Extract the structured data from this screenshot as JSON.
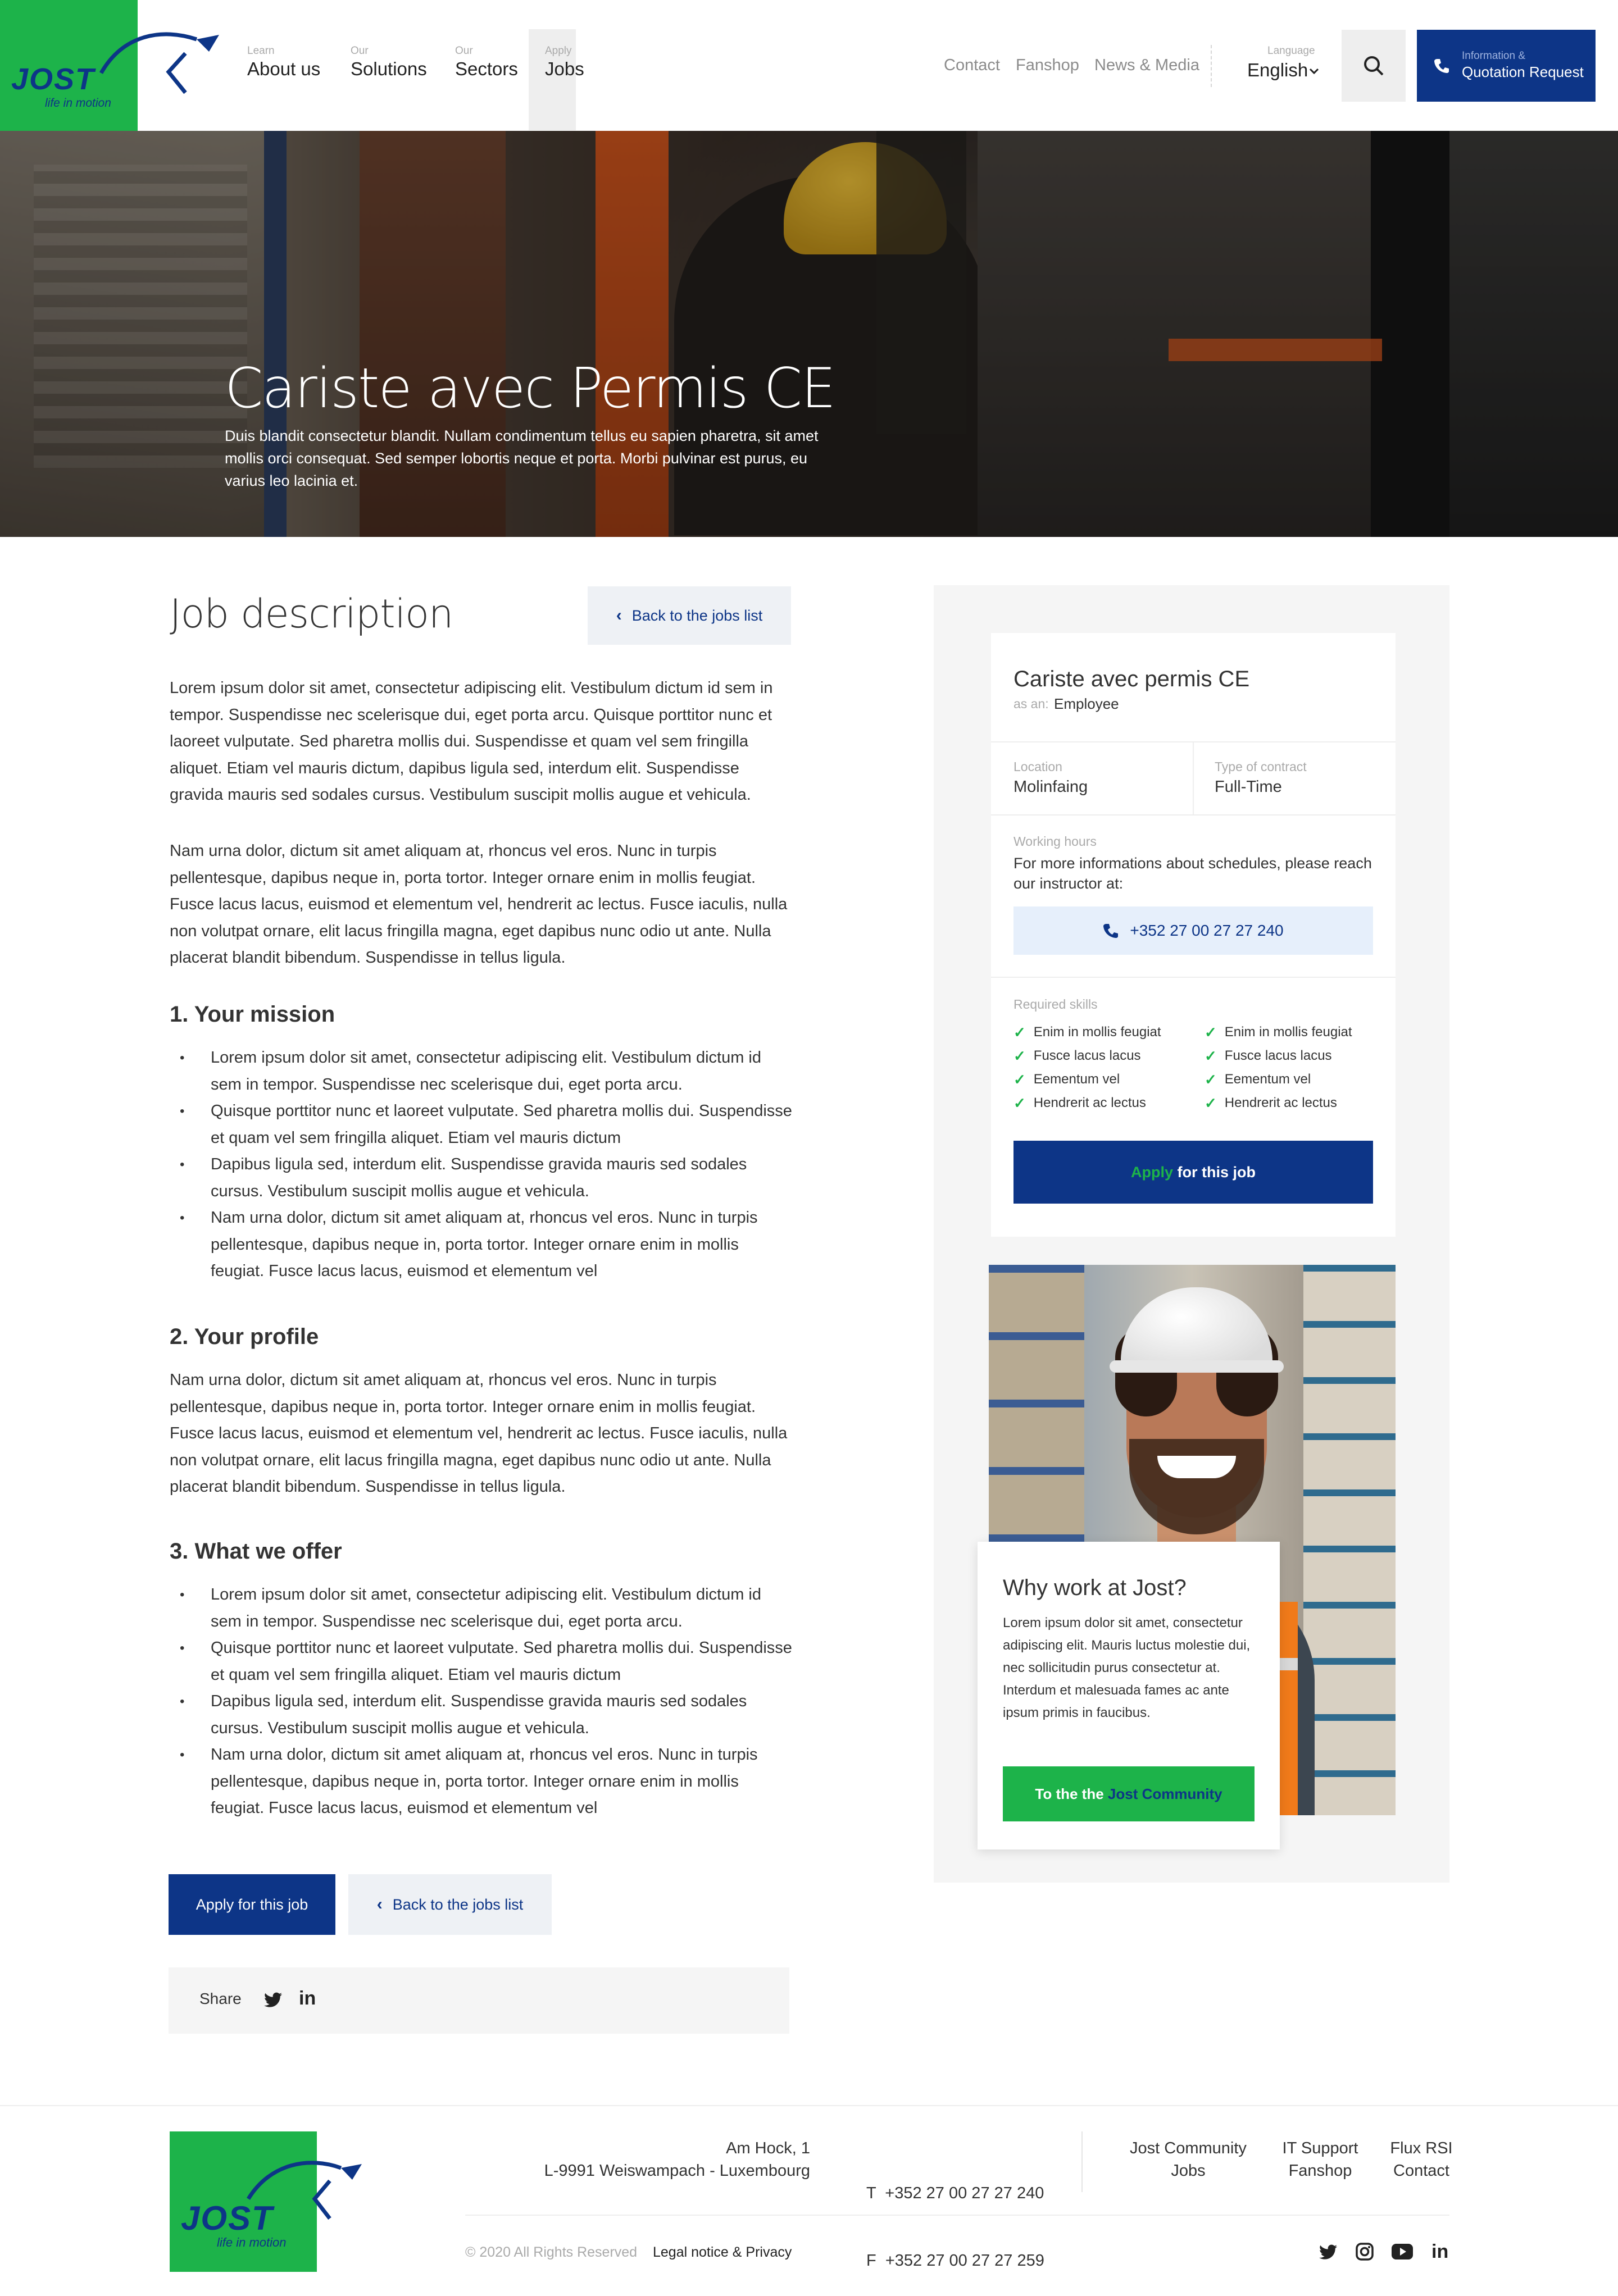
{
  "brand": {
    "name": "JOST",
    "tagline": "life in motion",
    "colors": {
      "green": "#1db34a",
      "navy": "#0d3587"
    }
  },
  "nav": {
    "items": [
      {
        "small": "Learn",
        "label": "About us"
      },
      {
        "small": "Our",
        "label": "Solutions"
      },
      {
        "small": "Our",
        "label": "Sectors"
      },
      {
        "small": "Apply",
        "label": "Jobs"
      }
    ],
    "utility": [
      "Contact",
      "Fanshop",
      "News & Media"
    ],
    "language": {
      "small": "Language",
      "value": "English"
    },
    "search_icon": "search-icon",
    "cta": {
      "small": "Information &",
      "label": "Quotation Request",
      "icon": "phone-icon"
    }
  },
  "hero": {
    "title": "Cariste avec Permis CE",
    "text": "Duis blandit consectetur blandit. Nullam condimentum tellus eu sapien pharetra, sit amet mollis orci consequat. Sed semper lobortis neque et porta. Morbi pulvinar est purus, eu varius leo lacinia et."
  },
  "main": {
    "title": "Job description",
    "back_label": "Back to the jobs list",
    "intro1": "Lorem ipsum dolor sit amet, consectetur adipiscing elit. Vestibulum dictum id sem in tempor. Suspendisse nec scelerisque dui, eget porta arcu. Quisque porttitor nunc et laoreet vulputate. Sed pharetra mollis dui. Suspendisse et quam vel sem fringilla aliquet. Etiam vel mauris dictum, dapibus ligula sed, interdum elit. Suspendisse gravida mauris sed sodales cursus. Vestibulum suscipit mollis augue et vehicula.",
    "intro2": "Nam urna dolor, dictum sit amet aliquam at, rhoncus vel eros. Nunc in turpis pellentesque, dapibus neque in, porta tortor. Integer ornare enim in mollis feugiat. Fusce lacus lacus, euismod et elementum vel, hendrerit ac lectus. Fusce iaculis, nulla non volutpat ornare, elit lacus fringilla magna, eget dapibus nunc odio ut ante. Nulla placerat blandit bibendum. Suspendisse in tellus ligula.",
    "mission": {
      "title": "1. Your mission",
      "items": [
        "Lorem ipsum dolor sit amet, consectetur adipiscing elit. Vestibulum dictum id sem in tempor. Suspendisse nec scelerisque dui, eget porta arcu.",
        "Quisque porttitor nunc et laoreet vulputate. Sed pharetra mollis dui. Suspendisse et quam vel sem fringilla aliquet. Etiam vel mauris dictum",
        "Dapibus ligula sed, interdum elit. Suspendisse gravida mauris sed sodales cursus. Vestibulum suscipit mollis augue et vehicula.",
        "Nam urna dolor, dictum sit amet aliquam at, rhoncus vel eros. Nunc in turpis pellentesque, dapibus neque in, porta tortor. Integer ornare enim in mollis feugiat. Fusce lacus lacus, euismod et elementum vel"
      ]
    },
    "profile": {
      "title": "2. Your profile",
      "text": "Nam urna dolor, dictum sit amet aliquam at, rhoncus vel eros. Nunc in turpis pellentesque, dapibus neque in, porta tortor. Integer ornare enim in mollis feugiat. Fusce lacus lacus, euismod et elementum vel, hendrerit ac lectus. Fusce iaculis, nulla non volutpat ornare, elit lacus fringilla magna, eget dapibus nunc odio ut ante. Nulla placerat blandit bibendum. Suspendisse in tellus ligula."
    },
    "offer": {
      "title": "3. What we offer",
      "items": [
        "Lorem ipsum dolor sit amet, consectetur adipiscing elit. Vestibulum dictum id sem in tempor. Suspendisse nec scelerisque dui, eget porta arcu.",
        "Quisque porttitor nunc et laoreet vulputate. Sed pharetra mollis dui. Suspendisse et quam vel sem fringilla aliquet. Etiam vel mauris dictum",
        "Dapibus ligula sed, interdum elit. Suspendisse gravida mauris sed sodales cursus. Vestibulum suscipit mollis augue et vehicula.",
        "Nam urna dolor, dictum sit amet aliquam at, rhoncus vel eros. Nunc in turpis pellentesque, dapibus neque in, porta tortor. Integer ornare enim in mollis feugiat. Fusce lacus lacus, euismod et elementum vel"
      ]
    },
    "apply_label": "Apply for this job",
    "share_label": "Share",
    "share_icons": [
      "twitter-icon",
      "linkedin-icon"
    ]
  },
  "card": {
    "title": "Cariste avec permis CE",
    "as_label": "as an:",
    "as_value": "Employee",
    "location_label": "Location",
    "location_value": "Molinfaing",
    "contract_label": "Type of contract",
    "contract_value": "Full-Time",
    "hours_label": "Working hours",
    "hours_text": "For more informations about schedules, please reach our instructor at:",
    "phone": "+352 27 00 27 27 240",
    "skills_label": "Required skills",
    "skills_left": [
      "Enim in mollis feugiat",
      "Fusce lacus lacus",
      "Eementum vel",
      "Hendrerit ac lectus"
    ],
    "skills_right": [
      "Enim in mollis feugiat",
      "Fusce lacus lacus",
      "Eementum vel",
      "Hendrerit ac lectus"
    ],
    "apply_green": "Apply",
    "apply_rest": " for this job"
  },
  "why": {
    "title": "Why work at Jost?",
    "text": "Lorem ipsum dolor sit amet, consectetur adipiscing elit. Mauris luctus molestie dui, nec sollicitudin purus consectetur at. Interdum et malesuada fames ac ante ipsum primis in faucibus.",
    "btn_white": "To the the ",
    "btn_navy": "Jost Community"
  },
  "footer": {
    "address1": "Am Hock, 1",
    "address2": "L-9991 Weiswampach - Luxembourg",
    "phone": "T  +352 27 00 27 27 240",
    "fax": "F  +352 27 00 27 27 259",
    "links": [
      [
        "Jost Community",
        "Jobs"
      ],
      [
        "IT Support",
        "Fanshop"
      ],
      [
        "Flux RSI",
        "Contact"
      ]
    ],
    "copyright": "© 2020 All Rights Reserved",
    "legal": "Legal notice & Privacy",
    "social": [
      "twitter-icon",
      "instagram-icon",
      "youtube-icon",
      "linkedin-icon"
    ]
  }
}
